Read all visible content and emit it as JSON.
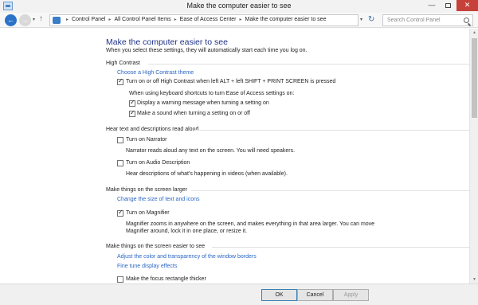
{
  "window": {
    "title": "Make the computer easier to see",
    "minimize_glyph": "—",
    "close_glyph": "✕"
  },
  "nav": {
    "back_glyph": "←",
    "forward_glyph": "→",
    "dropdown_glyph": "▾",
    "up_glyph": "↑",
    "refresh_glyph": "↻",
    "crumb_sep": "▸",
    "breadcrumbs": [
      "Control Panel",
      "All Control Panel Items",
      "Ease of Access Center",
      "Make the computer easier to see"
    ],
    "search_placeholder": "Search Control Panel"
  },
  "page": {
    "title": "Make the computer easier to see",
    "subtitle": "When you select these settings, they will automatically start each time you log on."
  },
  "high_contrast": {
    "heading": "High Contrast",
    "theme_link": "Choose a High Contrast theme",
    "toggle": {
      "label": "Turn on or off High Contrast when left ALT + left SHIFT + PRINT SCREEN is pressed",
      "checked": true
    },
    "shortcut_note": "When using keyboard shortcuts to turn Ease of Access settings on:",
    "warning": {
      "label": "Display a warning message when turning a setting on",
      "checked": true
    },
    "sound": {
      "label": "Make a sound when turning a setting on or off",
      "checked": true
    }
  },
  "text_descriptions": {
    "heading": "Hear text and descriptions read aloud",
    "narrator": {
      "label": "Turn on Narrator",
      "checked": false,
      "description": "Narrator reads aloud any text on the screen. You will need speakers."
    },
    "audio_description": {
      "label": "Turn on Audio Description",
      "checked": false,
      "description": "Hear descriptions of what's happening in videos (when available)."
    }
  },
  "larger": {
    "heading": "Make things on the screen larger",
    "size_link": "Change the size of text and icons",
    "magnifier": {
      "label": "Turn on Magnifier",
      "checked": true,
      "description_line1": "Magnifier zooms in anywhere on the screen, and makes everything in that area larger. You can move",
      "description_line2": "Magnifier around, lock it in one place, or resize it."
    }
  },
  "easier": {
    "heading": "Make things on the screen easier to see",
    "color_link": "Adjust the color and transparency of the window borders",
    "effects_link": "Fine tune display effects",
    "focus": {
      "label": "Make the focus rectangle thicker",
      "checked": false
    }
  },
  "footer": {
    "ok": "OK",
    "cancel": "Cancel",
    "apply": "Apply"
  },
  "colors": {
    "title_blue": "#1e3287",
    "link_blue": "#2a66c4",
    "close_red": "#c7413b"
  }
}
